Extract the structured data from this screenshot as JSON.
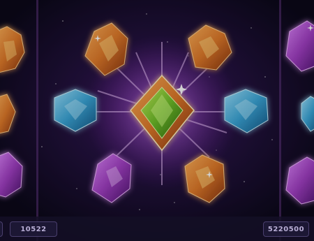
{
  "hud": {
    "bet_value": "10522",
    "balance_value": "5220500"
  },
  "board": {
    "columns": [
      {
        "position": 1,
        "symbols": [
          "orange-gem",
          "orange-gem",
          "purple-gem"
        ]
      },
      {
        "position": 2,
        "symbols": [
          "orange-gem",
          "blue-gem",
          "purple-gem"
        ]
      },
      {
        "position": 3,
        "symbols": [
          "orange-gem",
          "wild-star-gem",
          "orange-gem"
        ]
      },
      {
        "position": 4,
        "symbols": [
          "purple-gem",
          "blue-gem",
          "purple-gem"
        ]
      }
    ],
    "highlighted_symbol": "wild-star-gem"
  },
  "colors": {
    "background": "#0d0a1e",
    "orange_gem": "#e07a2a",
    "blue_gem": "#3ba7d9",
    "purple_gem": "#a23fc4",
    "green_core": "#6fbf2a",
    "hud_text": "#b9aed6",
    "hud_border": "#4a3f6e"
  }
}
